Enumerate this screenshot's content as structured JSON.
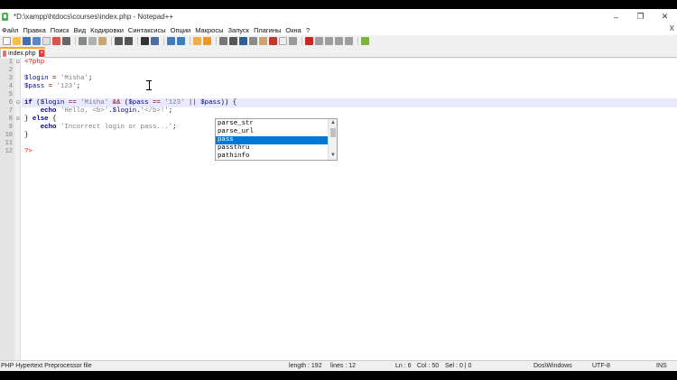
{
  "window": {
    "title": "*D:\\xampp\\htdocs\\courses\\index.php - Notepad++",
    "minimize": "–",
    "restore": "❐",
    "close": "✕"
  },
  "menu": {
    "items": [
      "Файл",
      "Правка",
      "Поиск",
      "Вид",
      "Кодировки",
      "Синтаксисы",
      "Опции",
      "Макросы",
      "Запуск",
      "Плагины",
      "Окна",
      "?"
    ],
    "close_doc": "X"
  },
  "tabs": [
    {
      "label": "index.php",
      "close": "×"
    }
  ],
  "editor": {
    "line_numbers": [
      "1",
      "2",
      "3",
      "4",
      "5",
      "6",
      "7",
      "8",
      "9",
      "10",
      "11",
      "12"
    ],
    "lines": [
      "<?php",
      "",
      "$login = 'Misha';",
      "$pass = '123';",
      "",
      "if ($login == 'Misha' && ($pass == '123' || $pass)) {",
      "    echo 'Hello, <b>'.$login.'</b>!';",
      "} else {",
      "    echo 'Incorrect login or pass...';",
      "}",
      "",
      "?>"
    ],
    "current_line": 6
  },
  "autocomplete": {
    "items": [
      "parse_str",
      "parse_url",
      "pass",
      "passthru",
      "pathinfo"
    ],
    "selected_index": 2
  },
  "status": {
    "file_type": "PHP Hypertext Preprocessor file",
    "length": "length : 192",
    "lines": "lines : 12",
    "ln": "Ln : 6",
    "col": "Col : 50",
    "sel": "Sel : 0 | 0",
    "eol": "Dos\\Windows",
    "encoding": "UTF-8",
    "mode": "INS"
  },
  "colors": {
    "keyword": "#00008b",
    "string": "#808080",
    "php_tag": "#ff0000",
    "current_line": "#e8e8ff",
    "selection": "#0078d7"
  }
}
